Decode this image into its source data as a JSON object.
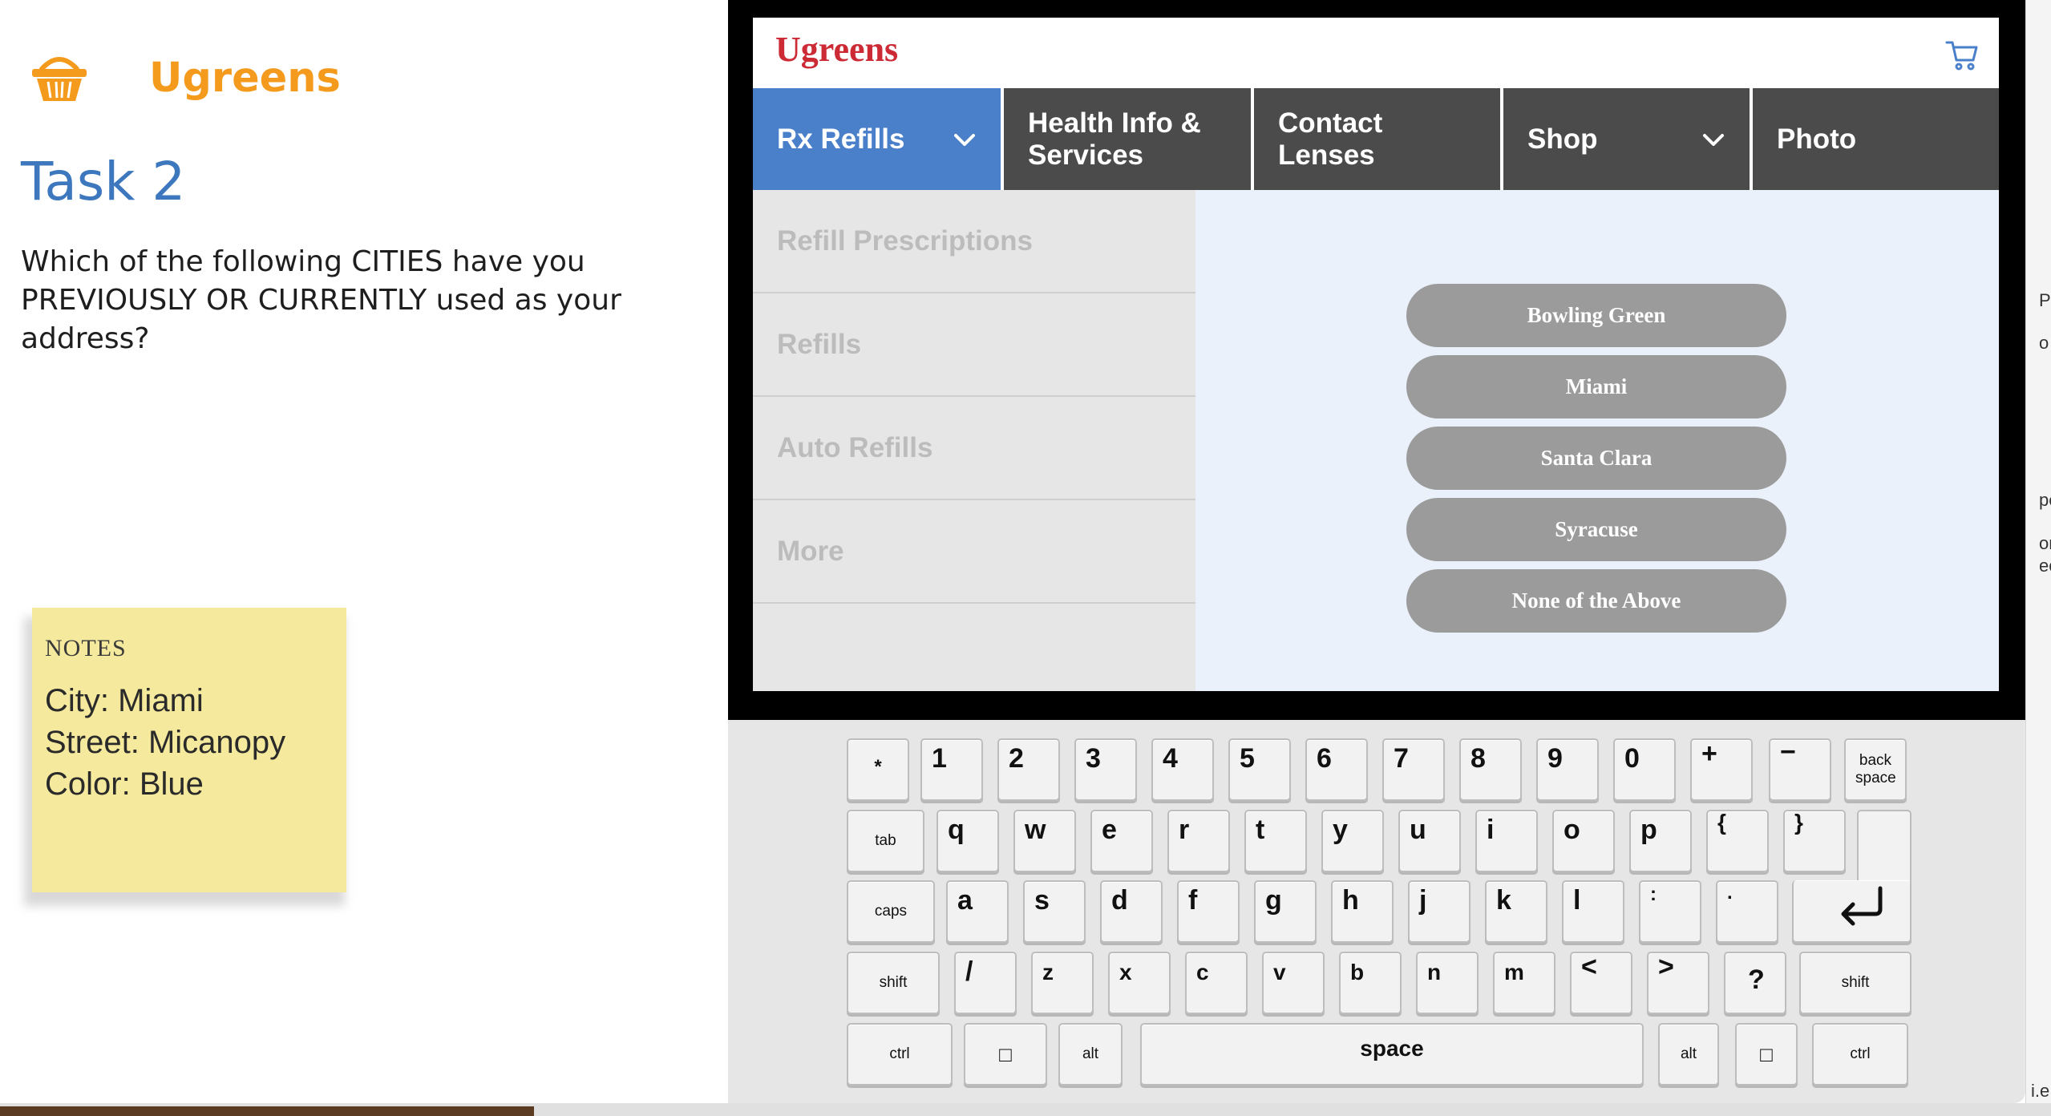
{
  "brand": {
    "name": "Ugreens",
    "color": "#f49a1c"
  },
  "task": {
    "title": "Task 2",
    "question": "Which of the following CITIES have you PREVIOUSLY OR CURRENTLY used as your address?"
  },
  "notes": {
    "heading": "NOTES",
    "lines": [
      "City: Miami",
      "Street: Micanopy",
      "Color: Blue"
    ]
  },
  "kiosk": {
    "logo": "Ugreens",
    "cart_icon": "cart-icon",
    "nav": [
      {
        "label": "Rx Refills",
        "has_dropdown": true,
        "active": true
      },
      {
        "label": "Health Info & Services",
        "has_dropdown": false
      },
      {
        "label": "Contact Lenses",
        "has_dropdown": false
      },
      {
        "label": "Shop",
        "has_dropdown": true
      },
      {
        "label": "Photo",
        "has_dropdown": false
      }
    ],
    "submenu": [
      "Refill Prescriptions",
      "Refills",
      "Auto Refills",
      "More"
    ],
    "options": [
      "Bowling Green",
      "Miami",
      "Santa Clara",
      "Syracuse",
      "None of the Above"
    ]
  },
  "keyboard": {
    "row1": [
      "*",
      "1",
      "2",
      "3",
      "4",
      "5",
      "6",
      "7",
      "8",
      "9",
      "0",
      "+",
      "−",
      "back space"
    ],
    "row2": [
      "tab",
      "q",
      "w",
      "e",
      "r",
      "t",
      "y",
      "u",
      "i",
      "o",
      "p",
      "{",
      "}"
    ],
    "row3": [
      "caps",
      "a",
      "s",
      "d",
      "f",
      "g",
      "h",
      "j",
      "k",
      "l",
      ":",
      ".",
      "enter"
    ],
    "row4": [
      "shift",
      "/",
      "z",
      "x",
      "c",
      "v",
      "b",
      "n",
      "m",
      "<",
      ">",
      "?",
      "shift"
    ],
    "row5": [
      "ctrl",
      "□",
      "alt",
      "space",
      "alt",
      "□",
      "ctrl"
    ]
  },
  "edge_fragments": [
    "P",
    "o",
    "pe",
    "or",
    "ec",
    "i.e"
  ],
  "colors": {
    "accent_blue": "#4a80c9",
    "task_blue": "#3d77bd",
    "logo_red": "#cc2b36",
    "nav_dark": "#4b4b4b",
    "option_gray": "#9b9b9b",
    "note_yellow": "#f4e99c"
  }
}
